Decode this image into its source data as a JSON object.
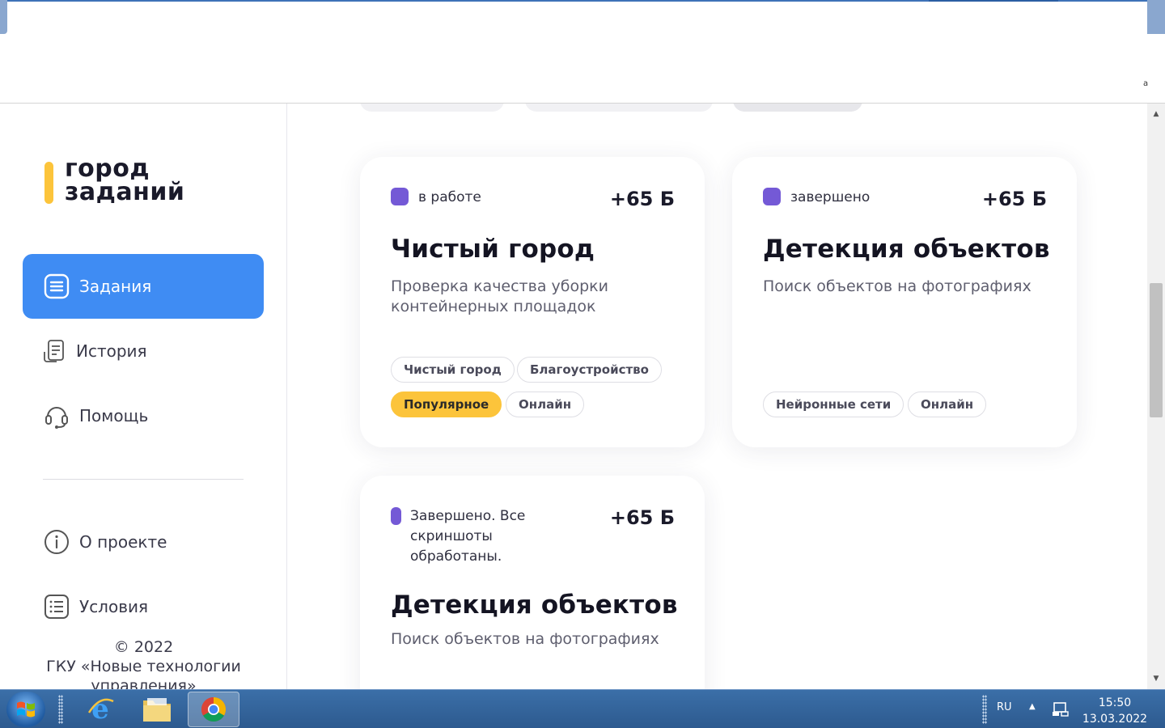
{
  "sidebar": {
    "logo": "город\nзаданий",
    "nav": [
      {
        "label": "Задания",
        "icon": "tasks-icon"
      },
      {
        "label": "История",
        "icon": "history-icon"
      },
      {
        "label": "Помощь",
        "icon": "headset-icon"
      },
      {
        "label": "О проекте",
        "icon": "info-icon"
      },
      {
        "label": "Условия",
        "icon": "terms-icon"
      }
    ],
    "footer": {
      "copyright": "© 2022",
      "org": "ГКУ «Новые технологии управления»"
    }
  },
  "cards": [
    {
      "status": "в работе",
      "points": "+65 Б",
      "title": "Чистый город",
      "description": "Проверка качества уборки контейнерных площадок",
      "tags": [
        "Чистый город",
        "Благоустройство",
        "Популярное",
        "Онлайн"
      ]
    },
    {
      "status": "завершено",
      "points": "+65 Б",
      "title": "Детекция объектов",
      "description": "Поиск объектов на фотографиях",
      "tags": [
        "Нейронные сети",
        "Онлайн"
      ]
    },
    {
      "status": "Завершено. Все скриншоты обработаны.",
      "points": "+65 Б",
      "title": "Детекция объектов",
      "description": "Поиск объектов на фотографиях",
      "tags": []
    }
  ],
  "taskbar": {
    "language": "RU",
    "time": "15:50",
    "date": "13.03.2022",
    "apps": [
      "internet-explorer-icon",
      "file-explorer-icon",
      "chrome-icon"
    ]
  },
  "colors": {
    "accent": "#3f8cf3",
    "status_dot": "#7459d6",
    "popular": "#fcc43b",
    "logo_bar": "#fcc43b"
  }
}
